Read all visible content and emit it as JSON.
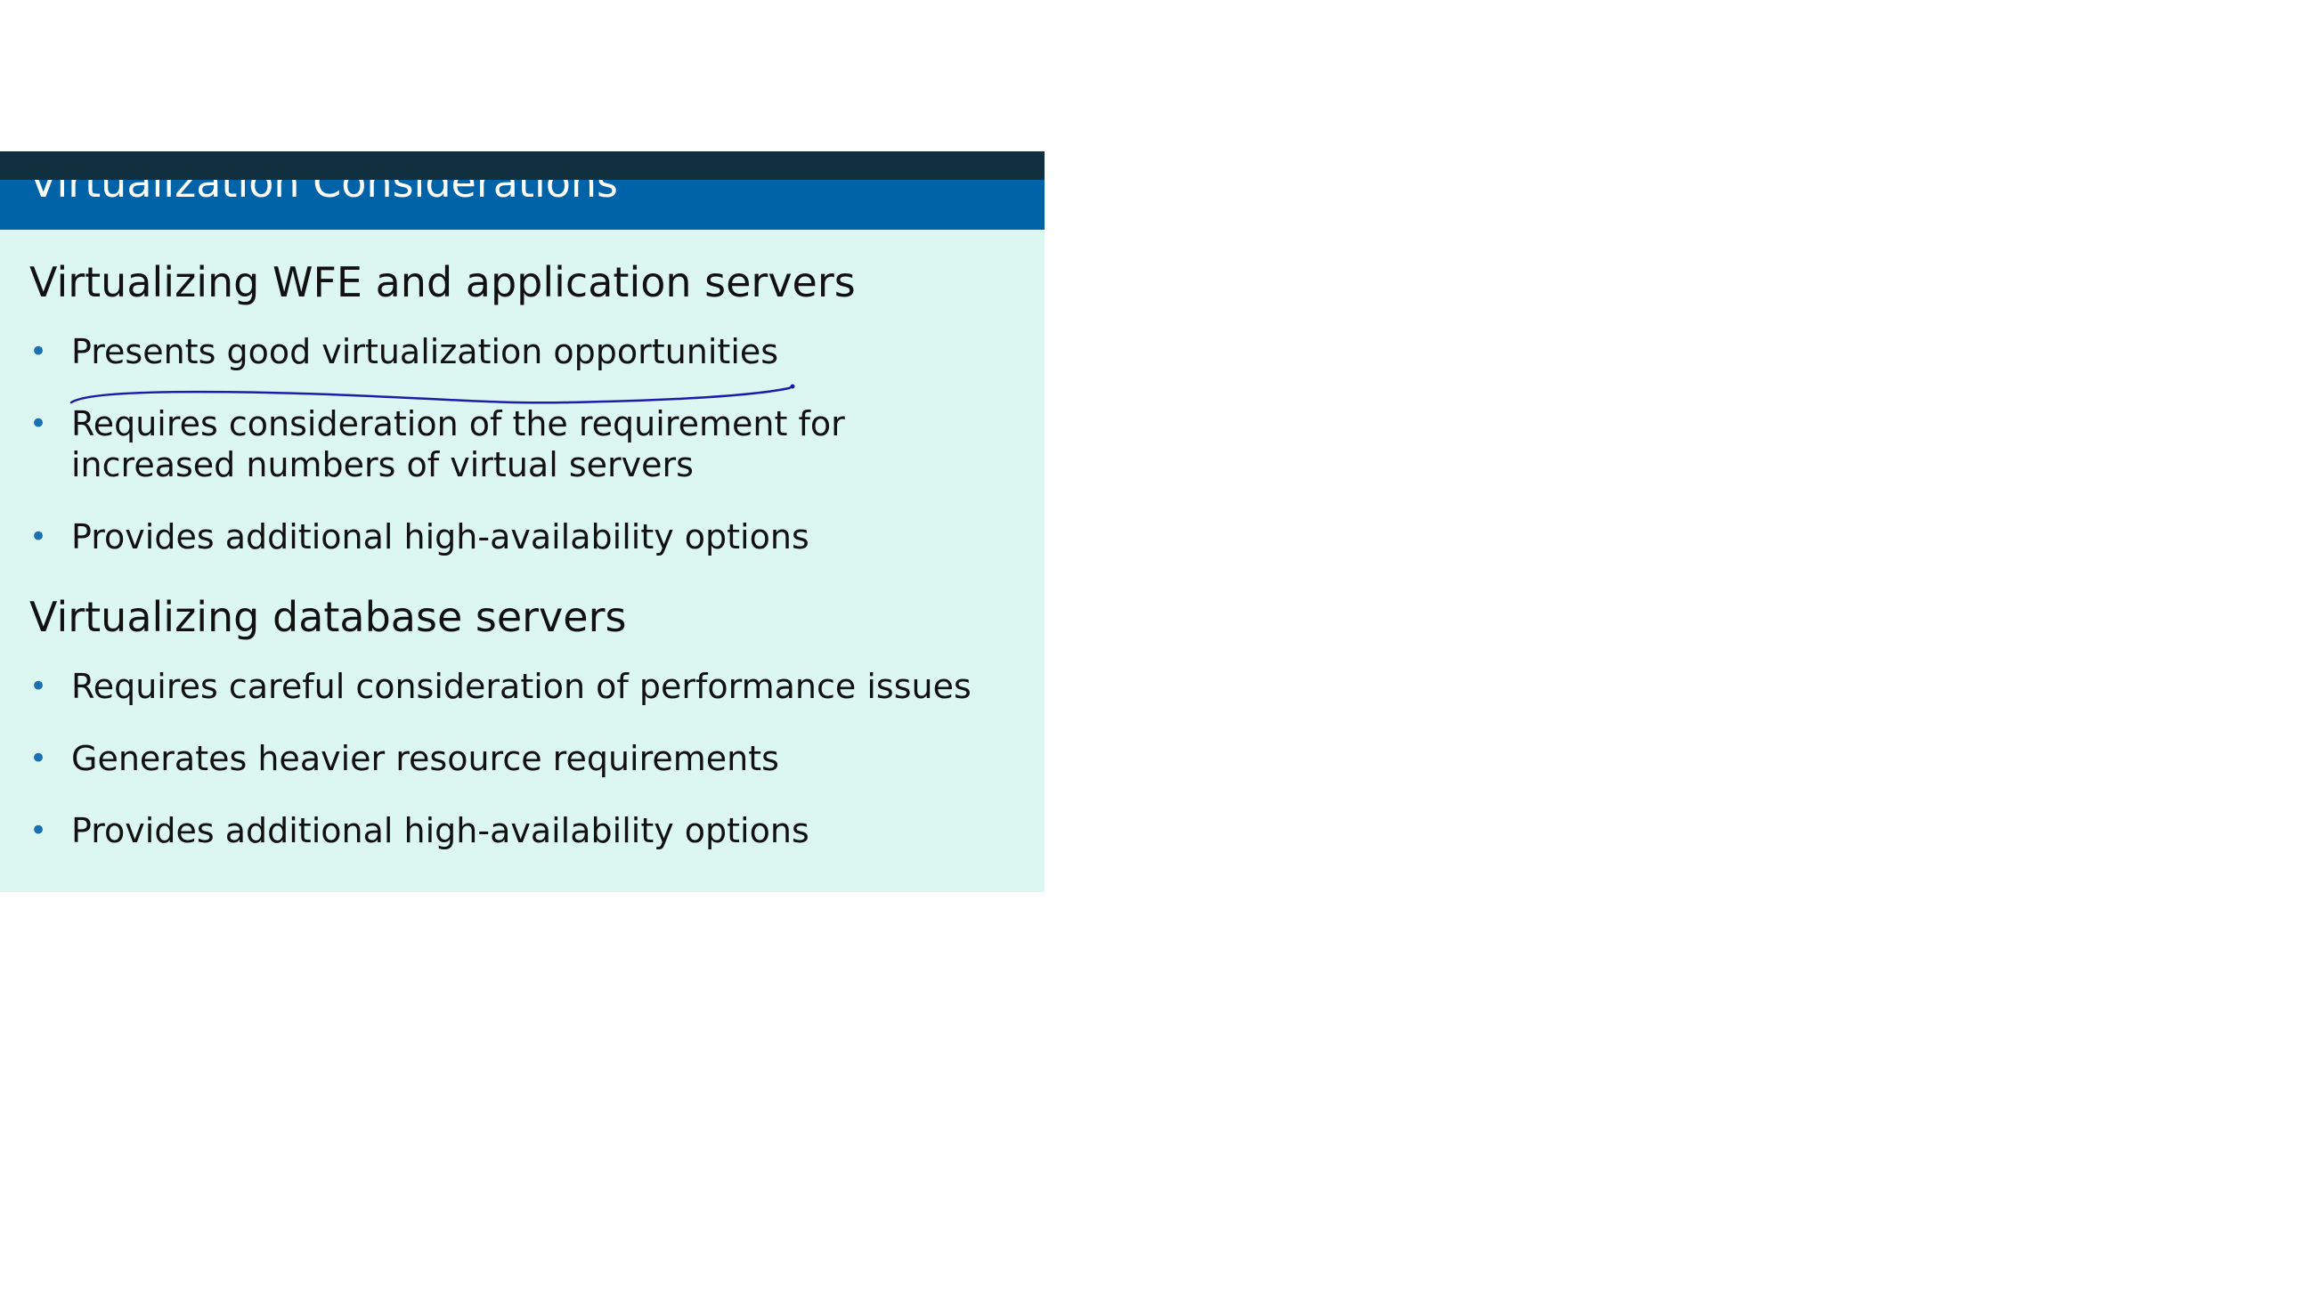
{
  "colors": {
    "title_bar": "#0063a8",
    "title_strip": "#11303f",
    "content_background": "#dcf7f2",
    "bullet": "#1a6fb0",
    "ink": "#1c1ca8"
  },
  "slide": {
    "title": "Virtualization Considerations",
    "sections": [
      {
        "heading": "Virtualizing WFE and application servers",
        "bullets": [
          "Presents good virtualization opportunities",
          "Requires consideration of the requirement for increased numbers of virtual servers",
          "Provides additional high-availability options"
        ]
      },
      {
        "heading": "Virtualizing database servers",
        "bullets": [
          "Requires careful consideration of performance issues",
          "Generates heavier resource requirements",
          "Provides additional high-availability options"
        ]
      }
    ]
  },
  "annotation": {
    "icon": "pen-underline-icon"
  }
}
